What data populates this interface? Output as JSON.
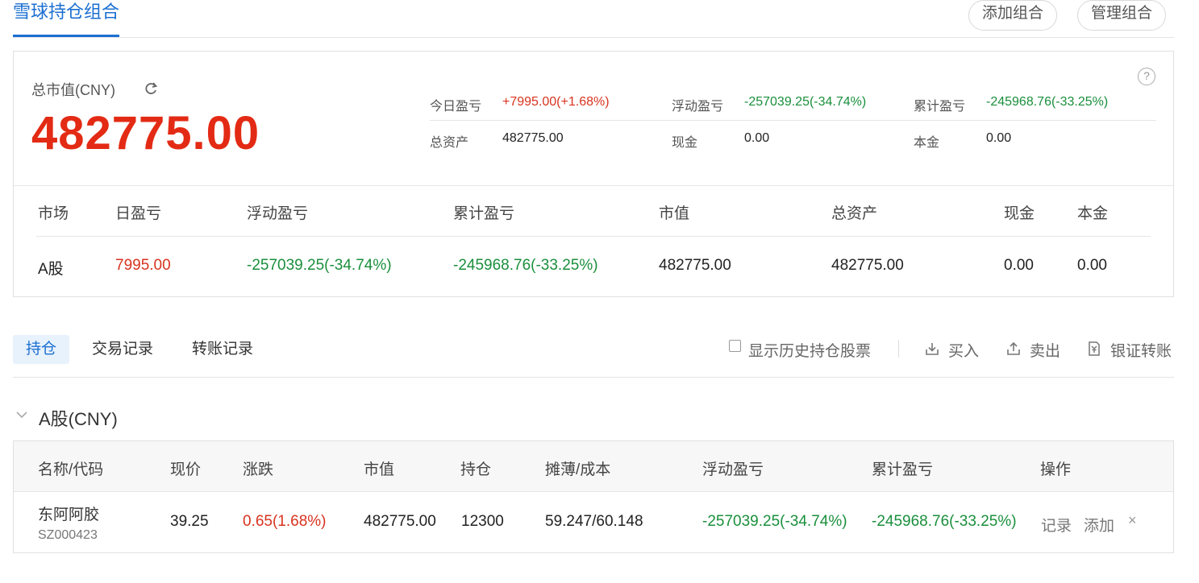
{
  "header": {
    "title": "雪球持仓组合",
    "add_btn": "添加组合",
    "manage_btn": "管理组合"
  },
  "summary": {
    "total_label": "总市值(CNY)",
    "total_value": "482775.00",
    "help": "?",
    "metrics": {
      "today_pl_label": "今日盈亏",
      "today_pl": "+7995.00(+1.68%)",
      "float_pl_label": "浮动盈亏",
      "float_pl": "-257039.25(-34.74%)",
      "cum_pl_label": "累计盈亏",
      "cum_pl": "-245968.76(-33.25%)",
      "total_assets_label": "总资产",
      "total_assets": "482775.00",
      "cash_label": "现金",
      "cash": "0.00",
      "principal_label": "本金",
      "principal": "0.00"
    },
    "market_table": {
      "headers": [
        "市场",
        "日盈亏",
        "浮动盈亏",
        "累计盈亏",
        "市值",
        "总资产",
        "现金",
        "本金"
      ],
      "row": [
        "A股",
        "7995.00",
        "-257039.25(-34.74%)",
        "-245968.76(-33.25%)",
        "482775.00",
        "482775.00",
        "0.00",
        "0.00"
      ]
    }
  },
  "tabs": {
    "holdings": "持仓",
    "trades": "交易记录",
    "transfers": "转账记录"
  },
  "toolbar": {
    "show_history": "显示历史持仓股票",
    "buy": "买入",
    "sell": "卖出",
    "transfer": "银证转账"
  },
  "section": {
    "title": "A股(CNY)"
  },
  "holdings_table": {
    "headers": [
      "名称/代码",
      "现价",
      "涨跌",
      "市值",
      "持仓",
      "摊薄/成本",
      "浮动盈亏",
      "累计盈亏",
      "操作"
    ],
    "rows": [
      {
        "name": "东阿阿胶",
        "code": "SZ000423",
        "price": "39.25",
        "change": "0.65(1.68%)",
        "market_value": "482775.00",
        "shares": "12300",
        "cost": "59.247/60.148",
        "float_pl": "-257039.25(-34.74%)",
        "cum_pl": "-245968.76(-33.25%)",
        "op_record": "记录",
        "op_add": "添加",
        "op_remove": "×"
      }
    ]
  },
  "colors": {
    "accent": "#1b6fd1",
    "up": "#d8331f",
    "down": "#1a8f3c",
    "big_value": "#e32a14"
  }
}
